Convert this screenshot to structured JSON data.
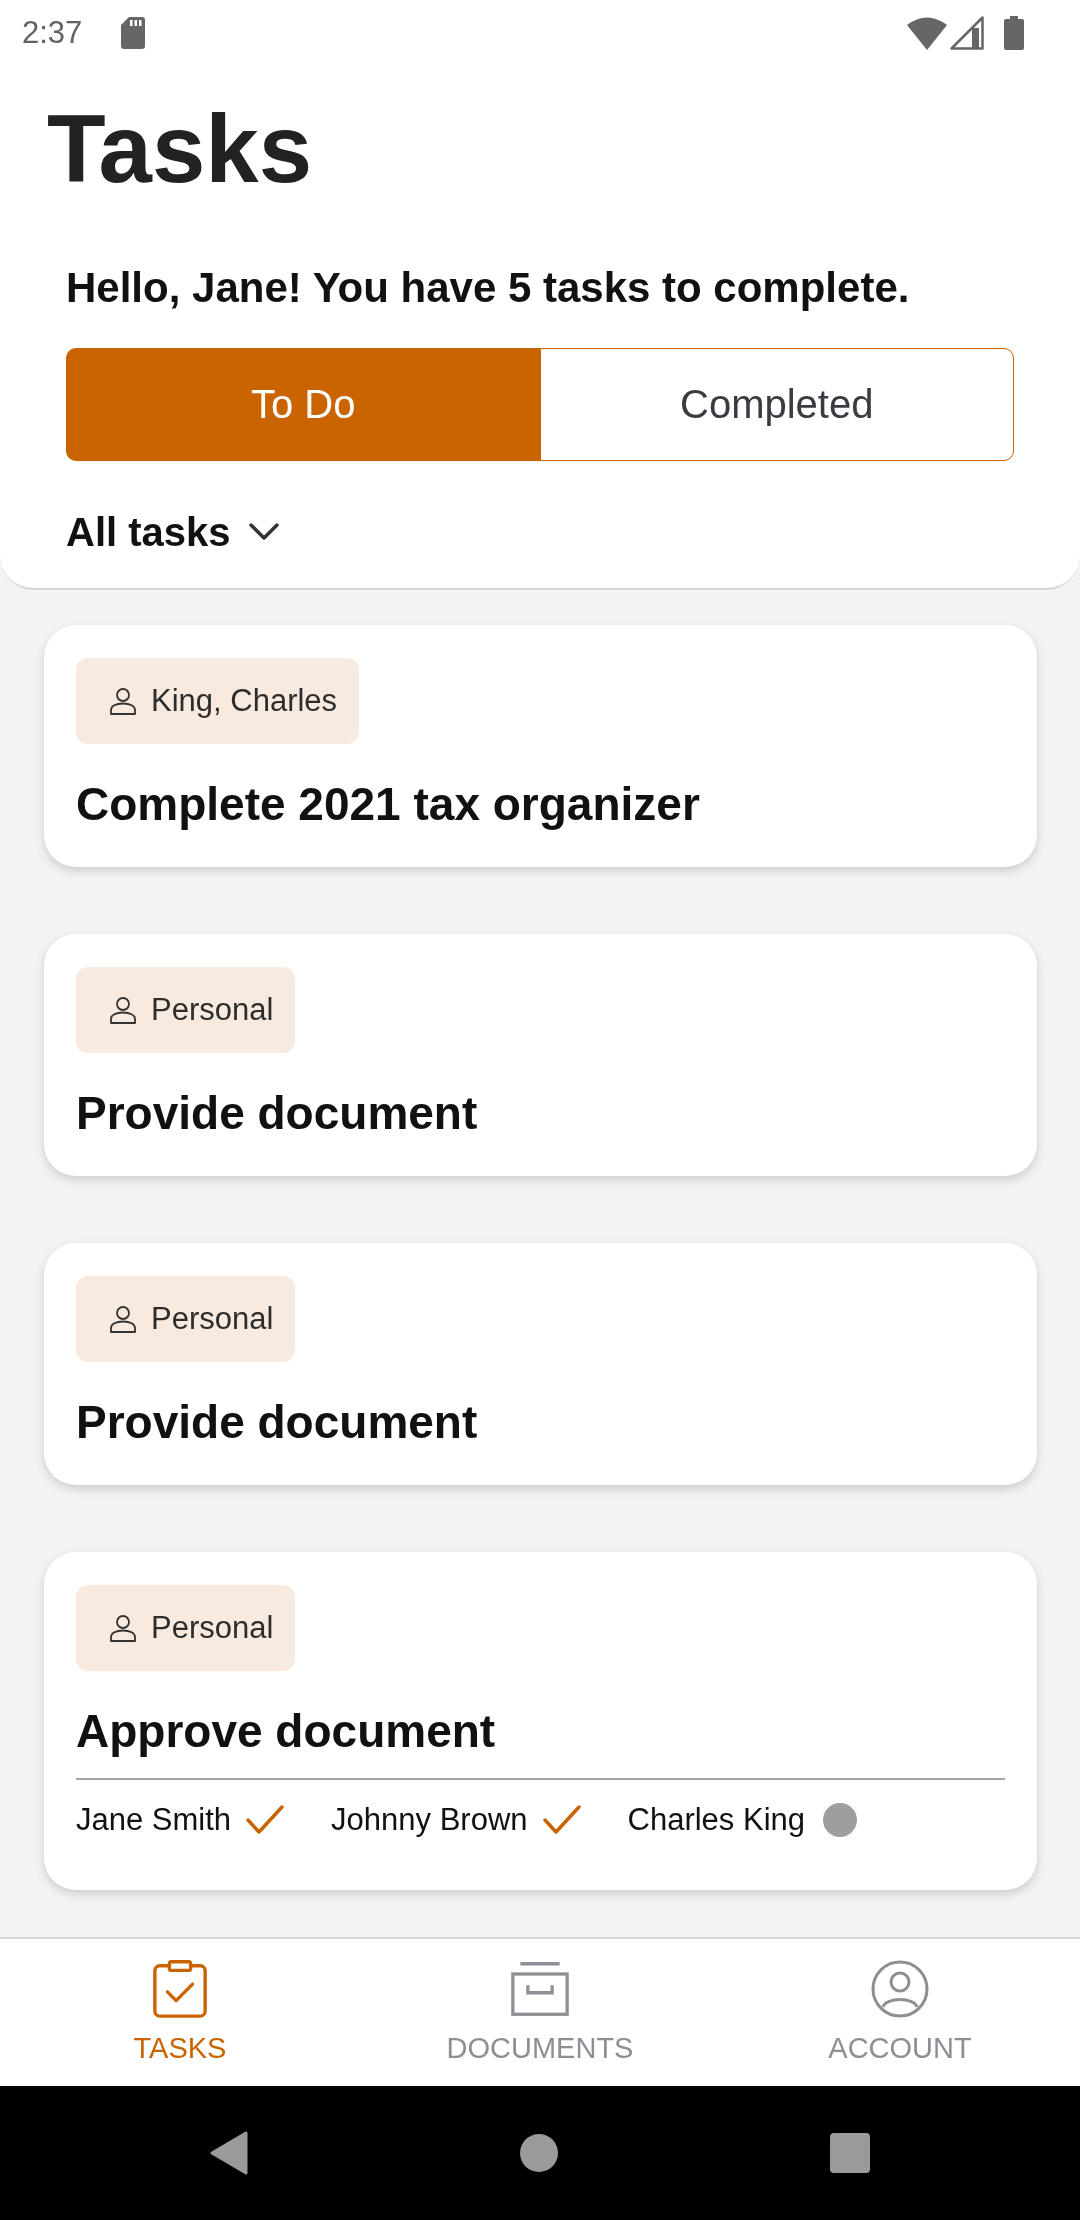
{
  "status_bar": {
    "time": "2:37"
  },
  "header": {
    "title": "Tasks",
    "greeting": "Hello, Jane! You have 5 tasks to complete."
  },
  "tabs": [
    {
      "label": "To Do",
      "selected": true
    },
    {
      "label": "Completed",
      "selected": false
    }
  ],
  "filter": {
    "label": "All tasks"
  },
  "tasks": [
    {
      "tag": "King, Charles",
      "title": "Complete 2021 tax organizer"
    },
    {
      "tag": "Personal",
      "title": "Provide document"
    },
    {
      "tag": "Personal",
      "title": "Provide document"
    },
    {
      "tag": "Personal",
      "title": "Approve document",
      "approvers": [
        {
          "name": "Jane Smith",
          "approved": true
        },
        {
          "name": "Johnny Brown",
          "approved": true
        },
        {
          "name": "Charles King",
          "approved": false
        }
      ]
    }
  ],
  "bottom_nav": [
    {
      "label": "TASKS",
      "selected": true
    },
    {
      "label": "DOCUMENTS",
      "selected": false
    },
    {
      "label": "ACCOUNT",
      "selected": false
    }
  ]
}
